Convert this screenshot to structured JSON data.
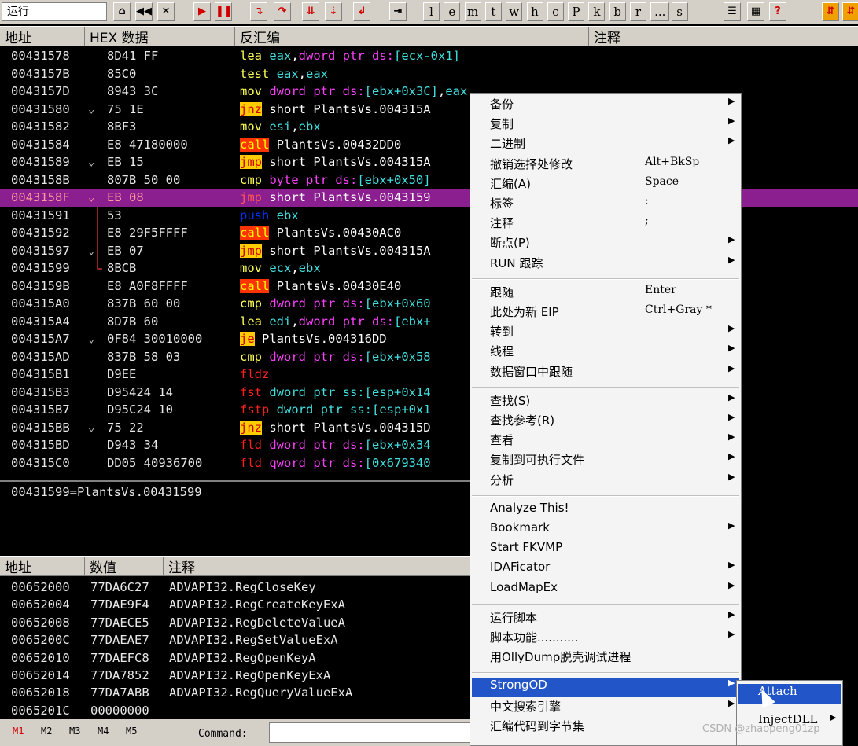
{
  "toolbar": {
    "run_status": "运行",
    "letters": [
      "l",
      "e",
      "m",
      "t",
      "w",
      "h",
      "c",
      "P",
      "k",
      "b",
      "r",
      "...",
      "s"
    ]
  },
  "cpu_header": {
    "addr": "地址",
    "hex": "HEX 数据",
    "disasm": "反汇编",
    "comment": "注释"
  },
  "cpu_rows": [
    {
      "addr": "00431578",
      "jm": "",
      "hex": "8D41 FF",
      "p": [
        {
          "t": "lea ",
          "k": "mn"
        },
        {
          "t": "eax",
          "k": "op"
        },
        {
          "t": ",",
          "k": "ptext"
        },
        {
          "t": "dword ptr ds:",
          "k": "mem"
        },
        {
          "t": "[ecx-0x1]",
          "k": "op"
        }
      ]
    },
    {
      "addr": "0043157B",
      "jm": "",
      "hex": "85C0",
      "p": [
        {
          "t": "test ",
          "k": "mn"
        },
        {
          "t": "eax",
          "k": "op"
        },
        {
          "t": ",",
          "k": "ptext"
        },
        {
          "t": "eax",
          "k": "op"
        }
      ]
    },
    {
      "addr": "0043157D",
      "jm": "",
      "hex": "8943 3C",
      "p": [
        {
          "t": "mov ",
          "k": "mn"
        },
        {
          "t": "dword ptr ds:",
          "k": "mem"
        },
        {
          "t": "[ebx+0x3C]",
          "k": "op"
        },
        {
          "t": ",",
          "k": "ptext"
        },
        {
          "t": "eax",
          "k": "op"
        }
      ]
    },
    {
      "addr": "00431580",
      "jm": "⌄",
      "hex": "75 1E",
      "p": [
        {
          "t": "jnz",
          "k": "jmpbox"
        },
        {
          "t": " short PlantsVs.004315A",
          "k": "ptext"
        }
      ]
    },
    {
      "addr": "00431582",
      "jm": "",
      "hex": "8BF3",
      "p": [
        {
          "t": "mov ",
          "k": "mn"
        },
        {
          "t": "esi",
          "k": "op"
        },
        {
          "t": ",",
          "k": "ptext"
        },
        {
          "t": "ebx",
          "k": "op"
        }
      ]
    },
    {
      "addr": "00431584",
      "jm": "",
      "hex": "E8 47180000",
      "p": [
        {
          "t": "call",
          "k": "callbox"
        },
        {
          "t": " PlantsVs.00432DD0",
          "k": "ptext"
        }
      ]
    },
    {
      "addr": "00431589",
      "jm": "⌄",
      "hex": "EB 15",
      "p": [
        {
          "t": "jmp",
          "k": "jmpbox"
        },
        {
          "t": " short PlantsVs.004315A",
          "k": "ptext"
        }
      ]
    },
    {
      "addr": "0043158B",
      "jm": "",
      "hex": "807B 50 00",
      "p": [
        {
          "t": "cmp ",
          "k": "mn"
        },
        {
          "t": "byte ptr ds:",
          "k": "mem"
        },
        {
          "t": "[ebx+0x50]",
          "k": "op"
        }
      ]
    },
    {
      "addr": "0043158F",
      "jm": "⌄",
      "hex": "EB 08",
      "sel": true,
      "p": [
        {
          "t": "jmp",
          "k": "jmpbox"
        },
        {
          "t": " short PlantsVs.0043159",
          "k": "ptext"
        }
      ]
    },
    {
      "addr": "00431591",
      "jm": "",
      "hex": "53",
      "p": [
        {
          "t": "push ",
          "k": "pushc"
        },
        {
          "t": "ebx",
          "k": "op"
        }
      ]
    },
    {
      "addr": "00431592",
      "jm": "",
      "hex": "E8 29F5FFFF",
      "p": [
        {
          "t": "call",
          "k": "callbox"
        },
        {
          "t": " PlantsVs.00430AC0",
          "k": "ptext"
        }
      ]
    },
    {
      "addr": "00431597",
      "jm": "⌄",
      "hex": "EB 07",
      "p": [
        {
          "t": "jmp",
          "k": "jmpbox"
        },
        {
          "t": " short PlantsVs.004315A",
          "k": "ptext"
        }
      ]
    },
    {
      "addr": "00431599",
      "jm": "",
      "hex": "8BCB",
      "p": [
        {
          "t": "mov ",
          "k": "mn"
        },
        {
          "t": "ecx",
          "k": "op"
        },
        {
          "t": ",",
          "k": "ptext"
        },
        {
          "t": "ebx",
          "k": "op"
        }
      ]
    },
    {
      "addr": "0043159B",
      "jm": "",
      "hex": "E8 A0F8FFFF",
      "p": [
        {
          "t": "call",
          "k": "callbox"
        },
        {
          "t": " PlantsVs.00430E40",
          "k": "ptext"
        }
      ]
    },
    {
      "addr": "004315A0",
      "jm": "",
      "hex": "837B 60 00",
      "p": [
        {
          "t": "cmp ",
          "k": "mn"
        },
        {
          "t": "dword ptr ds:",
          "k": "mem"
        },
        {
          "t": "[ebx+0x60",
          "k": "op"
        }
      ]
    },
    {
      "addr": "004315A4",
      "jm": "",
      "hex": "8D7B 60",
      "p": [
        {
          "t": "lea ",
          "k": "mn"
        },
        {
          "t": "edi",
          "k": "op"
        },
        {
          "t": ",",
          "k": "ptext"
        },
        {
          "t": "dword ptr ds:",
          "k": "mem"
        },
        {
          "t": "[ebx+",
          "k": "op"
        }
      ]
    },
    {
      "addr": "004315A7",
      "jm": "⌄",
      "hex": "0F84 30010000",
      "p": [
        {
          "t": "je",
          "k": "jmpbox"
        },
        {
          "t": " PlantsVs.004316DD",
          "k": "ptext"
        }
      ]
    },
    {
      "addr": "004315AD",
      "jm": "",
      "hex": "837B 58 03",
      "p": [
        {
          "t": "cmp ",
          "k": "mn"
        },
        {
          "t": "dword ptr ds:",
          "k": "mem"
        },
        {
          "t": "[ebx+0x58",
          "k": "op"
        }
      ]
    },
    {
      "addr": "004315B1",
      "jm": "",
      "hex": "D9EE",
      "p": [
        {
          "t": "fldz",
          "k": "fpu"
        }
      ]
    },
    {
      "addr": "004315B3",
      "jm": "",
      "hex": "D95424 14",
      "p": [
        {
          "t": "fst ",
          "k": "fpu"
        },
        {
          "t": "dword ptr ss:",
          "k": "op"
        },
        {
          "t": "[esp+0x14",
          "k": "op"
        }
      ]
    },
    {
      "addr": "004315B7",
      "jm": "",
      "hex": "D95C24 10",
      "p": [
        {
          "t": "fstp ",
          "k": "fpu"
        },
        {
          "t": "dword ptr ss:",
          "k": "op"
        },
        {
          "t": "[esp+0x1",
          "k": "op"
        }
      ]
    },
    {
      "addr": "004315BB",
      "jm": "⌄",
      "hex": "75 22",
      "p": [
        {
          "t": "jnz",
          "k": "jmpbox"
        },
        {
          "t": " short PlantsVs.004315D",
          "k": "ptext"
        }
      ]
    },
    {
      "addr": "004315BD",
      "jm": "",
      "hex": "D943 34",
      "p": [
        {
          "t": "fld ",
          "k": "fpu"
        },
        {
          "t": "dword ptr ds:",
          "k": "mem"
        },
        {
          "t": "[ebx+0x34",
          "k": "op"
        }
      ]
    },
    {
      "addr": "004315C0",
      "jm": "",
      "hex": "DD05 40936700",
      "p": [
        {
          "t": "fld ",
          "k": "fpu"
        },
        {
          "t": "qword ptr ds:",
          "k": "mem"
        },
        {
          "t": "[0x679340",
          "k": "op"
        }
      ]
    }
  ],
  "info_text": "00431599=PlantsVs.00431599",
  "dump_header": {
    "addr": "地址",
    "value": "数值",
    "comment": "注释"
  },
  "dump_rows": [
    {
      "addr": "00652000",
      "val": "77DA6C27",
      "cmt": "ADVAPI32.RegCloseKey"
    },
    {
      "addr": "00652004",
      "val": "77DAE9F4",
      "cmt": "ADVAPI32.RegCreateKeyExA"
    },
    {
      "addr": "00652008",
      "val": "77DAECE5",
      "cmt": "ADVAPI32.RegDeleteValueA"
    },
    {
      "addr": "0065200C",
      "val": "77DAEAE7",
      "cmt": "ADVAPI32.RegSetValueExA"
    },
    {
      "addr": "00652010",
      "val": "77DAEFC8",
      "cmt": "ADVAPI32.RegOpenKeyA"
    },
    {
      "addr": "00652014",
      "val": "77DA7852",
      "cmt": "ADVAPI32.RegOpenKeyExA"
    },
    {
      "addr": "00652018",
      "val": "77DA7ABB",
      "cmt": "ADVAPI32.RegQueryValueExA"
    },
    {
      "addr": "0065201C",
      "val": "00000000",
      "cmt": ""
    }
  ],
  "status": {
    "m": [
      "M1",
      "M2",
      "M3",
      "M4",
      "M5"
    ],
    "command_label": "Command:"
  },
  "context_menu": [
    {
      "label": "备份",
      "sc": "",
      "arrow": true
    },
    {
      "label": "复制",
      "sc": "",
      "arrow": true
    },
    {
      "label": "二进制",
      "sc": "",
      "arrow": true
    },
    {
      "label": "撤销选择处修改",
      "sc": "Alt+BkSp",
      "arrow": false
    },
    {
      "label": "汇编(A)",
      "sc": "Space",
      "arrow": false
    },
    {
      "label": "标签",
      "sc": ":",
      "arrow": false
    },
    {
      "label": "注释",
      "sc": ";",
      "arrow": false
    },
    {
      "label": "断点(P)",
      "sc": "",
      "arrow": true
    },
    {
      "label": "RUN 跟踪",
      "sc": "",
      "arrow": true
    },
    {
      "sep": true
    },
    {
      "label": "跟随",
      "sc": "Enter",
      "arrow": false
    },
    {
      "label": "此处为新 EIP",
      "sc": "Ctrl+Gray *",
      "arrow": false
    },
    {
      "label": "转到",
      "sc": "",
      "arrow": true
    },
    {
      "label": "线程",
      "sc": "",
      "arrow": true
    },
    {
      "label": "数据窗口中跟随",
      "sc": "",
      "arrow": true
    },
    {
      "sep": true
    },
    {
      "label": "查找(S)",
      "sc": "",
      "arrow": true
    },
    {
      "label": "查找参考(R)",
      "sc": "",
      "arrow": true
    },
    {
      "label": "查看",
      "sc": "",
      "arrow": true
    },
    {
      "label": "复制到可执行文件",
      "sc": "",
      "arrow": true
    },
    {
      "label": "分析",
      "sc": "",
      "arrow": true
    },
    {
      "sep": true
    },
    {
      "label": "Analyze This!",
      "sc": "",
      "arrow": false
    },
    {
      "label": "Bookmark",
      "sc": "",
      "arrow": true
    },
    {
      "label": "Start FKVMP",
      "sc": "",
      "arrow": false
    },
    {
      "label": "IDAFicator",
      "sc": "",
      "arrow": true
    },
    {
      "label": "LoadMapEx",
      "sc": "",
      "arrow": true
    },
    {
      "sep": true
    },
    {
      "label": "运行脚本",
      "sc": "",
      "arrow": true
    },
    {
      "label": "脚本功能...........",
      "sc": "",
      "arrow": true
    },
    {
      "label": "用OllyDump脱壳调试进程",
      "sc": "",
      "arrow": false
    },
    {
      "sep": true
    },
    {
      "label": "StrongOD",
      "sc": "",
      "arrow": true,
      "hl": true
    },
    {
      "label": "中文搜索引擎",
      "sc": "",
      "arrow": true
    },
    {
      "label": "汇编代码到字节集",
      "sc": "",
      "arrow": false
    }
  ],
  "submenu": [
    {
      "label": "Attach",
      "arrow": false,
      "hl": true
    },
    {
      "label": "InjectDLL",
      "arrow": true
    }
  ],
  "watermark": "CSDN @zhaopeng01zp"
}
